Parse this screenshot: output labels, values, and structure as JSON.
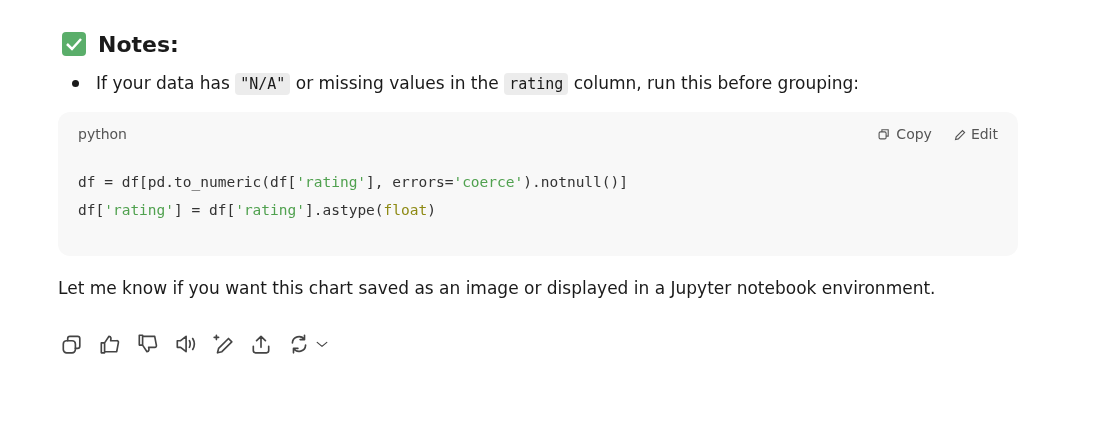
{
  "heading": {
    "text": "Notes:"
  },
  "bullets": [
    {
      "parts": [
        {
          "kind": "text",
          "text": "If your data has "
        },
        {
          "kind": "code",
          "text": "\"N/A\""
        },
        {
          "kind": "text",
          "text": " or missing values in the "
        },
        {
          "kind": "code",
          "text": "rating"
        },
        {
          "kind": "text",
          "text": " column, run this before grouping:"
        }
      ]
    }
  ],
  "code_block": {
    "language": "python",
    "copy_label": "Copy",
    "edit_label": "Edit",
    "lines": [
      [
        {
          "kind": "plain",
          "text": "df = df[pd.to_numeric(df["
        },
        {
          "kind": "string",
          "text": "'rating'"
        },
        {
          "kind": "plain",
          "text": "], errors="
        },
        {
          "kind": "string",
          "text": "'coerce'"
        },
        {
          "kind": "plain",
          "text": ").notnull()]"
        }
      ],
      [
        {
          "kind": "plain",
          "text": "df["
        },
        {
          "kind": "string",
          "text": "'rating'"
        },
        {
          "kind": "plain",
          "text": "] = df["
        },
        {
          "kind": "string",
          "text": "'rating'"
        },
        {
          "kind": "plain",
          "text": "].astype("
        },
        {
          "kind": "builtin",
          "text": "float"
        },
        {
          "kind": "plain",
          "text": ")"
        }
      ]
    ]
  },
  "paragraph": "Let me know if you want this chart saved as an image or displayed in a Jupyter notebook environment."
}
